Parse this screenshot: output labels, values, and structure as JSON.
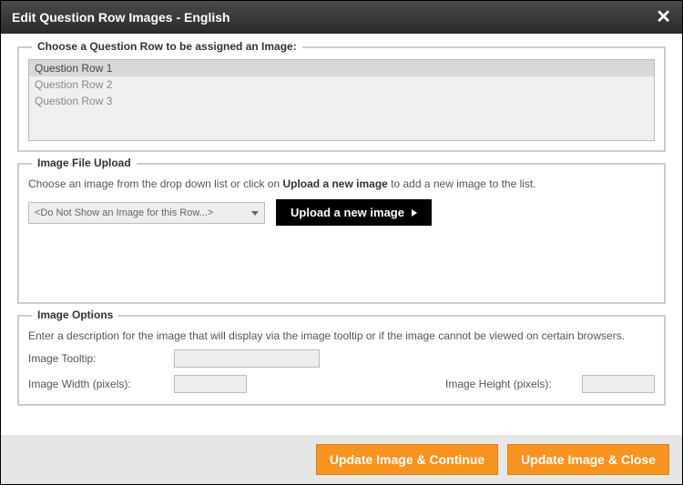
{
  "title": "Edit Question Row Images  -  English",
  "sections": {
    "choose": {
      "legend": "Choose a Question Row to be assigned an Image:",
      "rows": [
        "Question Row 1",
        "Question Row 2",
        "Question Row 3"
      ],
      "selected_index": 0
    },
    "upload": {
      "legend": "Image File Upload",
      "help_before": "Choose an image from the drop down list or click on ",
      "help_bold": "Upload a new image",
      "help_after": " to add a new image to the list.",
      "dropdown_value": "<Do Not Show an Image for this Row...>",
      "button_label": "Upload a new image"
    },
    "options": {
      "legend": "Image Options",
      "help": "Enter a description for the image that will display via the image tooltip or if the image cannot be viewed on certain browsers.",
      "tooltip_label": "Image Tooltip:",
      "tooltip_value": "",
      "width_label": "Image Width (pixels):",
      "width_value": "",
      "height_label": "Image Height (pixels):",
      "height_value": ""
    }
  },
  "footer": {
    "continue_label": "Update Image & Continue",
    "close_label": "Update Image & Close"
  }
}
